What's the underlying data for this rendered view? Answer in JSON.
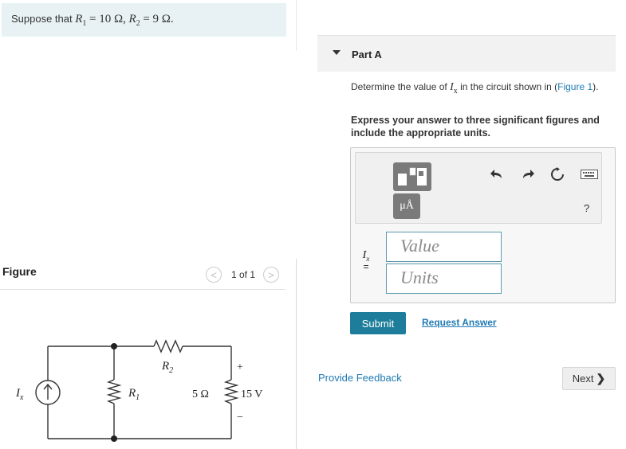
{
  "problem": {
    "intro_prefix": "Suppose that",
    "r1_symbol": "R",
    "r1_sub": "1",
    "r1_value": "= 10 Ω,",
    "r2_symbol": "R",
    "r2_sub": "2",
    "r2_value": "= 9 Ω."
  },
  "figure": {
    "label": "Figure",
    "prev_icon": "<",
    "next_icon": ">",
    "pager": "1 of 1"
  },
  "circuit": {
    "source_symbol": "I",
    "source_sub": "x",
    "r1_label": "R",
    "r1_sub": "1",
    "r2_label": "R",
    "r2_sub": "2",
    "r3_label": "5 Ω",
    "v_label": "15 V",
    "plus": "+",
    "minus": "−"
  },
  "part": {
    "title": "Part A",
    "question_prefix": "Determine the value of ",
    "question_var": "I",
    "question_var_sub": "x",
    "question_mid": " in the circuit shown in (",
    "question_link": "Figure 1",
    "question_suffix": ").",
    "instructions": "Express your answer to three significant figures and include the appropriate units."
  },
  "answer": {
    "unit_button": "μÅ",
    "help": "?",
    "var_symbol": "I",
    "var_sub": "x",
    "equals": "=",
    "value_placeholder": "Value",
    "units_placeholder": "Units"
  },
  "actions": {
    "submit": "Submit",
    "request_answer": "Request Answer",
    "feedback": "Provide Feedback",
    "next": "Next",
    "next_chevron": "❯"
  },
  "colors": {
    "accent": "#1d7d9a",
    "link": "#1f7ab3",
    "intro_bg": "#e8f2f4"
  }
}
